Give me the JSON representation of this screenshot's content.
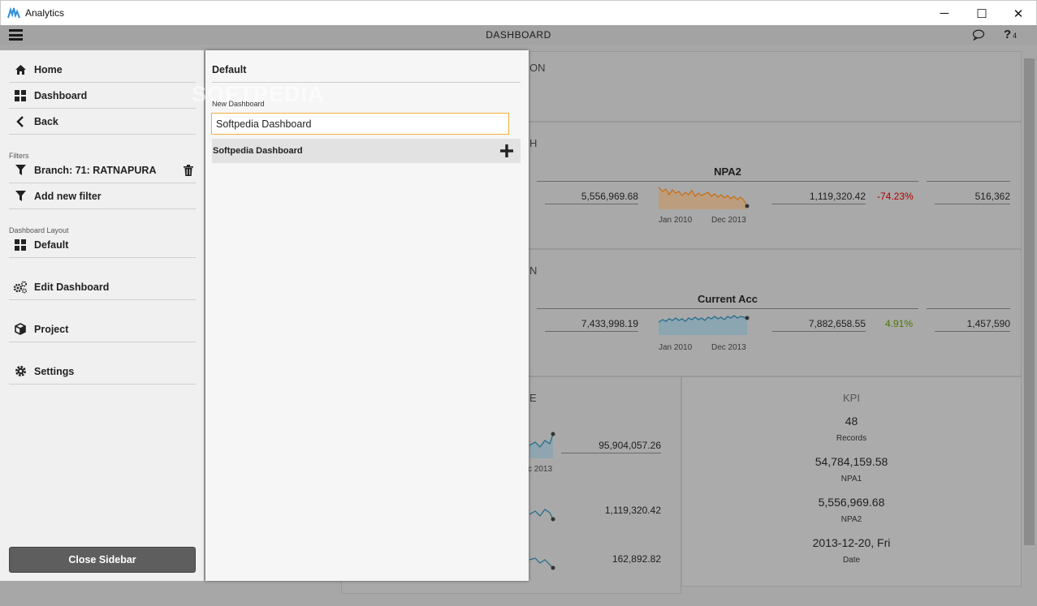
{
  "window": {
    "title": "Analytics",
    "minimize": "─",
    "maximize": "☐",
    "close": "✕"
  },
  "header": {
    "title": "DASHBOARD",
    "help_count": "4",
    "help_glyph": "?"
  },
  "sidebar": {
    "home": "Home",
    "dashboard": "Dashboard",
    "back": "Back",
    "filters_label": "Filters",
    "filter_branch": "Branch: 71: RATNAPURA",
    "add_filter": "Add new filter",
    "layout_label": "Dashboard Layout",
    "layout_default": "Default",
    "edit_dashboard": "Edit Dashboard",
    "project": "Project",
    "settings": "Settings",
    "close_sidebar": "Close Sidebar"
  },
  "layout_panel": {
    "heading": "Default",
    "new_label": "New Dashboard",
    "input_value": "Softpedia Dashboard",
    "list": [
      {
        "name": "Softpedia Dashboard"
      }
    ]
  },
  "watermark": "SOFTPEDIA",
  "background": {
    "section_a": "ON",
    "section_b": "H",
    "section_c": "N",
    "section_d": "E",
    "npa2": {
      "title": "NPA2",
      "left_value": "5,556,969.68",
      "value": "1,119,320.42",
      "change": "-74.23%",
      "right_value": "516,362",
      "x_start": "Jan 2010",
      "x_end": "Dec 2013"
    },
    "current_acc": {
      "title": "Current Acc",
      "left_value": "7,433,998.19",
      "value": "7,882,658.55",
      "change": "4.91%",
      "right_value": "1,457,590",
      "x_start": "Jan 2010",
      "x_end": "Dec 2013"
    },
    "lower_left": {
      "v1": "95,904,057.26",
      "v1_axis": "c 2013",
      "v2": "1,119,320.42",
      "v3": "162,892.82"
    },
    "kpi": {
      "title": "KPI",
      "items": [
        {
          "value": "48",
          "label": "Records"
        },
        {
          "value": "54,784,159.58",
          "label": "NPA1"
        },
        {
          "value": "5,556,969.68",
          "label": "NPA2"
        },
        {
          "value": "2013-12-20, Fri",
          "label": "Date"
        }
      ]
    }
  },
  "colors": {
    "accent_input": "#f0b23c",
    "negative": "#b00000",
    "positive": "#4a7a00"
  }
}
